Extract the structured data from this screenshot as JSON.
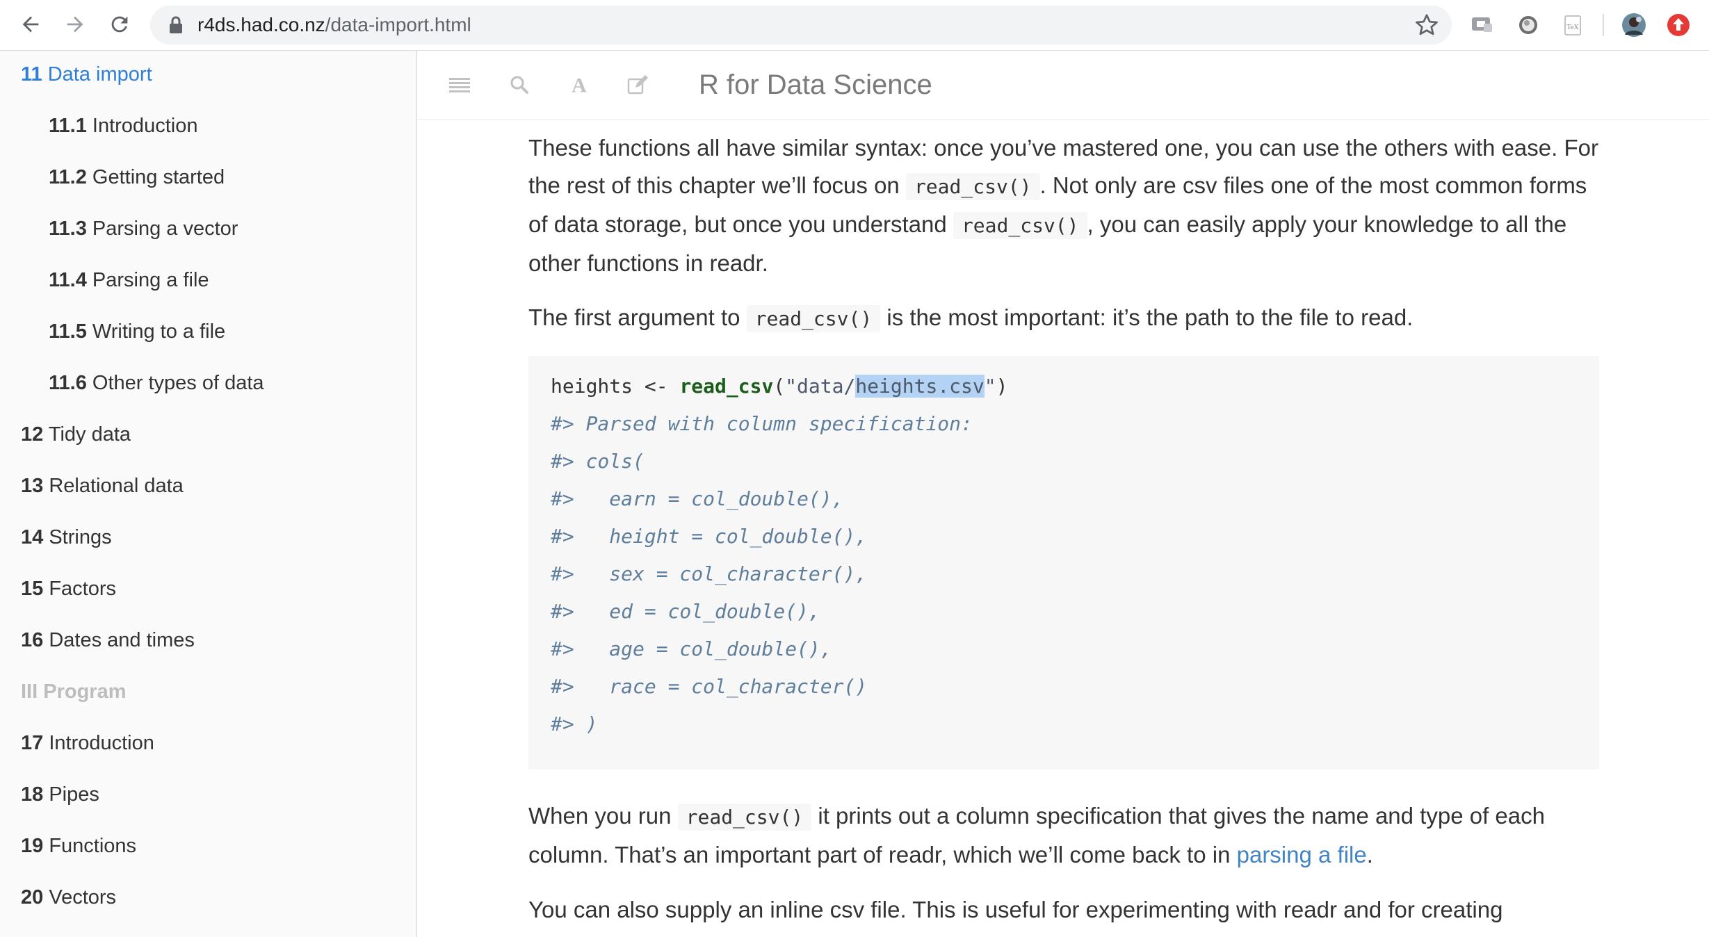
{
  "browser": {
    "url_host": "r4ds.had.co.nz",
    "url_path": "/data-import.html"
  },
  "sidebar": {
    "items": [
      {
        "num": "11",
        "label": "Data import",
        "level": 1,
        "active": true
      },
      {
        "num": "11.1",
        "label": "Introduction",
        "level": 2
      },
      {
        "num": "11.2",
        "label": "Getting started",
        "level": 2
      },
      {
        "num": "11.3",
        "label": "Parsing a vector",
        "level": 2
      },
      {
        "num": "11.4",
        "label": "Parsing a file",
        "level": 2
      },
      {
        "num": "11.5",
        "label": "Writing to a file",
        "level": 2
      },
      {
        "num": "11.6",
        "label": "Other types of data",
        "level": 2
      },
      {
        "num": "12",
        "label": "Tidy data",
        "level": 1
      },
      {
        "num": "13",
        "label": "Relational data",
        "level": 1
      },
      {
        "num": "14",
        "label": "Strings",
        "level": 1
      },
      {
        "num": "15",
        "label": "Factors",
        "level": 1
      },
      {
        "num": "16",
        "label": "Dates and times",
        "level": 1
      },
      {
        "num": "III",
        "label": "Program",
        "level": 0,
        "part": true
      },
      {
        "num": "17",
        "label": "Introduction",
        "level": 1
      },
      {
        "num": "18",
        "label": "Pipes",
        "level": 1
      },
      {
        "num": "19",
        "label": "Functions",
        "level": 1
      },
      {
        "num": "20",
        "label": "Vectors",
        "level": 1
      }
    ]
  },
  "toolbar": {
    "book_title": "R for Data Science",
    "icons": [
      "menu-icon",
      "search-icon",
      "font-icon",
      "edit-icon"
    ]
  },
  "content": {
    "p1": {
      "t1": "These functions all have similar syntax: once you’ve mastered one, you can use the others with ease. For the rest of this chapter we’ll focus on ",
      "c1": "read_csv()",
      "t2": ". Not only are csv files one of the most common forms of data storage, but once you understand ",
      "c2": "read_csv()",
      "t3": ", you can easily apply your knowledge to all the other functions in readr."
    },
    "p2": {
      "t1": "The first argument to ",
      "c1": "read_csv()",
      "t2": " is the most important: it’s the path to the file to read."
    },
    "code": {
      "line1": {
        "var": "heights <- ",
        "fn": "read_csv",
        "open": "(",
        "str_a": "\"data/",
        "str_sel": "heights.csv",
        "str_b": "\"",
        "close": ")"
      },
      "comments": [
        "#> Parsed with column specification:",
        "#> cols(",
        "#>   earn = col_double(),",
        "#>   height = col_double(),",
        "#>   sex = col_character(),",
        "#>   ed = col_double(),",
        "#>   age = col_double(),",
        "#>   race = col_character()",
        "#> )"
      ]
    },
    "p3": {
      "t1": "When you run ",
      "c1": "read_csv()",
      "t2": " it prints out a column specification that gives the name and type of each column. That’s an important part of readr, which we’ll come back to in ",
      "link": "parsing a file",
      "t3": "."
    },
    "p4": {
      "t1": "You can also supply an inline csv file. This is useful for experimenting with readr and for creating"
    }
  }
}
